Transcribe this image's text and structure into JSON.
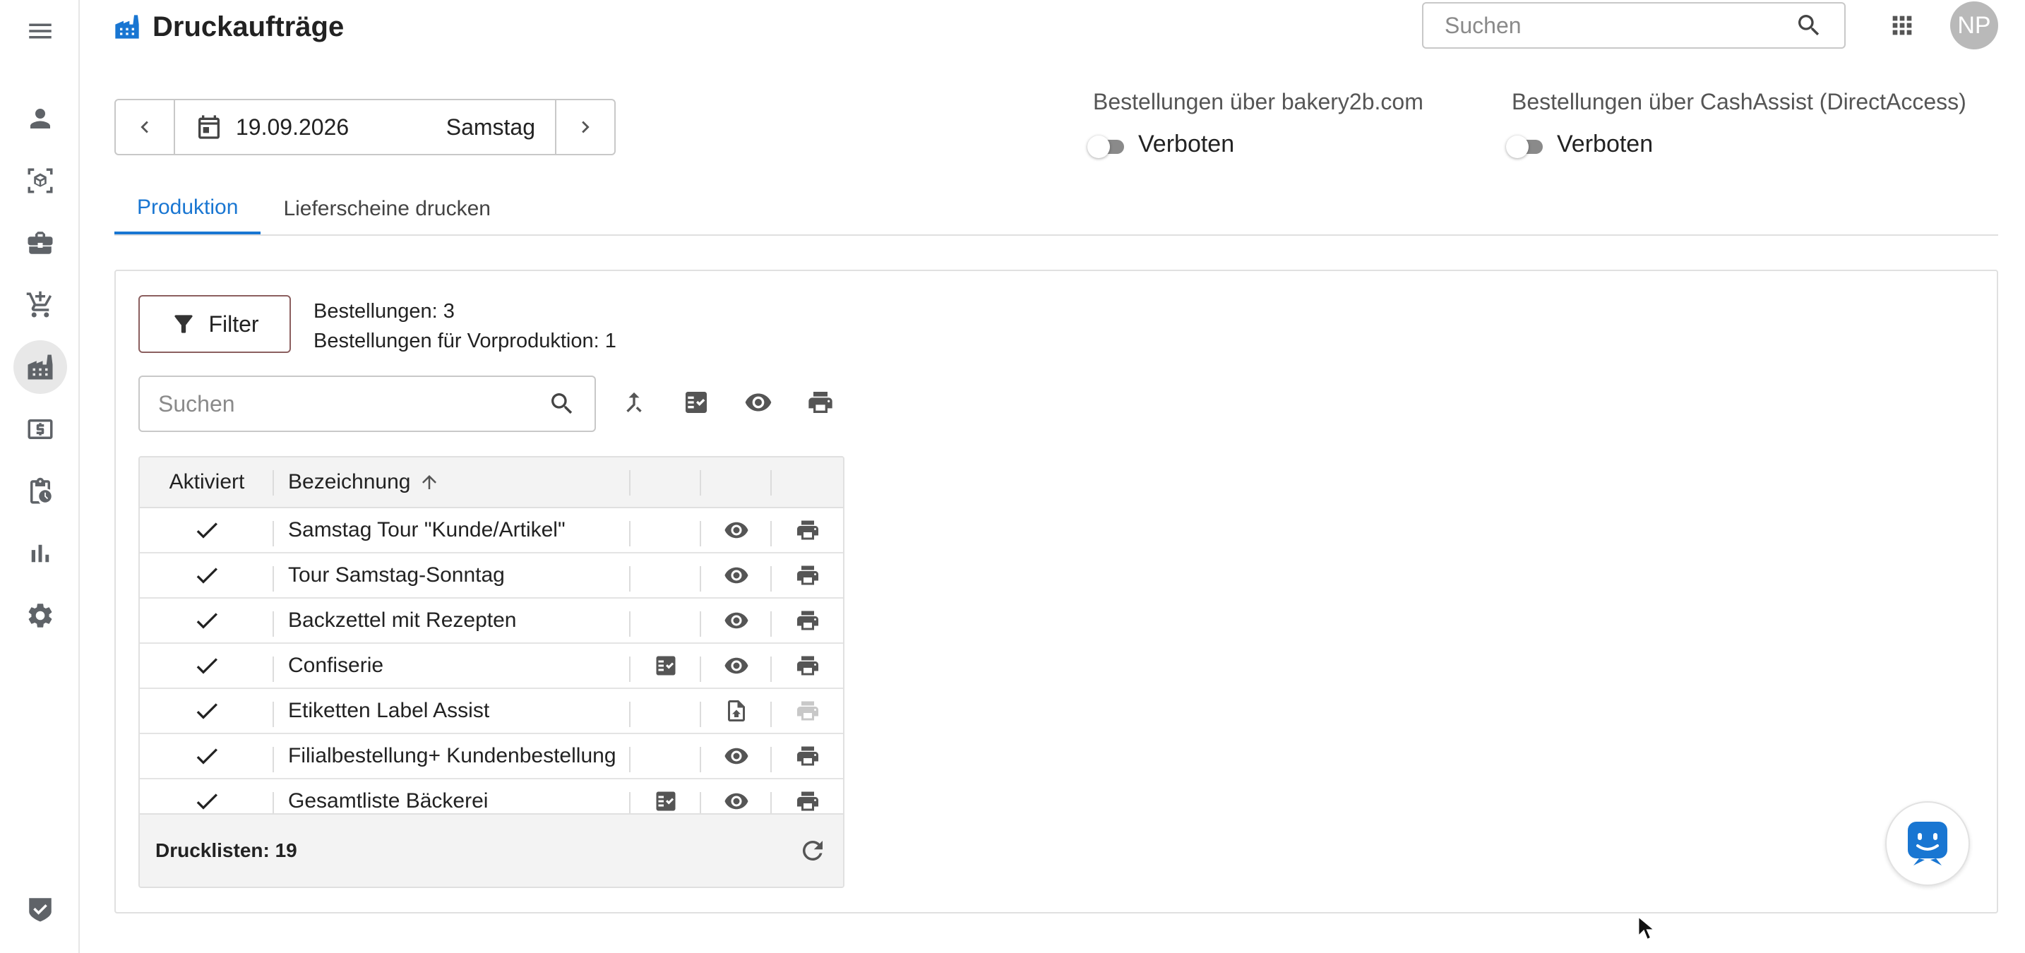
{
  "header": {
    "title": "Druckaufträge",
    "search_placeholder": "Suchen",
    "avatar_initials": "NP"
  },
  "date_picker": {
    "date": "19.09.2026",
    "weekday": "Samstag"
  },
  "orders": {
    "bakery": {
      "label": "Bestellungen über bakery2b.com",
      "state": "Verboten"
    },
    "cashassist": {
      "label": "Bestellungen über CashAssist (DirectAccess)",
      "state": "Verboten"
    }
  },
  "tabs": [
    {
      "label": "Produktion",
      "active": true
    },
    {
      "label": "Lieferscheine drucken",
      "active": false
    }
  ],
  "panel": {
    "filter_label": "Filter",
    "orders_count": "Bestellungen: 3",
    "preproduction_count": "Bestellungen für Vorproduktion: 1",
    "search_placeholder": "Suchen"
  },
  "table": {
    "columns": {
      "activated": "Aktiviert",
      "name": "Bezeichnung"
    },
    "rows": [
      {
        "name": "Samstag Tour \"Kunde/Artikel\"",
        "checklist": false,
        "view": "eye",
        "print_enabled": true
      },
      {
        "name": "Tour Samstag-Sonntag",
        "checklist": false,
        "view": "eye",
        "print_enabled": true
      },
      {
        "name": "Backzettel mit Rezepten",
        "checklist": false,
        "view": "eye",
        "print_enabled": true
      },
      {
        "name": "Confiserie",
        "checklist": true,
        "view": "eye",
        "print_enabled": true
      },
      {
        "name": "Etiketten Label Assist",
        "checklist": false,
        "view": "file-upload",
        "print_enabled": false
      },
      {
        "name": "Filialbestellung+ Kundenbestellung",
        "checklist": false,
        "view": "eye",
        "print_enabled": true
      },
      {
        "name": "Gesamtliste Bäckerei",
        "checklist": true,
        "view": "eye",
        "print_enabled": true
      }
    ],
    "footer": "Drucklisten: 19"
  },
  "colors": {
    "accent": "#1976d2",
    "icon": "#5f6368"
  }
}
